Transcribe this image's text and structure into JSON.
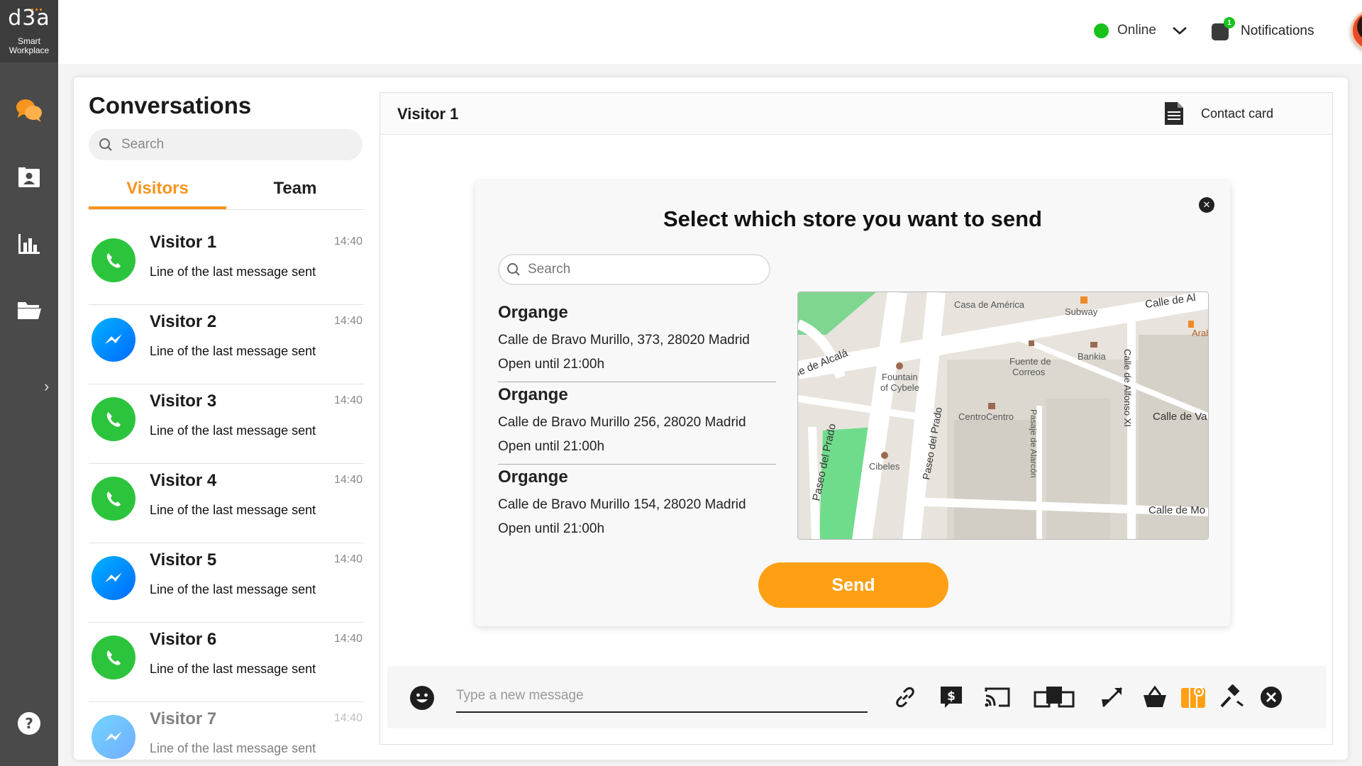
{
  "app": {
    "logo_mark": "d3a",
    "logo_line1": "Smart",
    "logo_line2": "Workplace"
  },
  "nav": {
    "items": [
      {
        "icon": "chat-bubbles-icon",
        "active": true
      },
      {
        "icon": "contacts-icon",
        "active": false
      },
      {
        "icon": "bar-chart-icon",
        "active": false
      },
      {
        "icon": "folder-icon",
        "active": false
      }
    ],
    "expand_glyph": "›",
    "help_glyph": "?"
  },
  "topbar": {
    "status_label": "Online",
    "status_color": "#17c21b",
    "notifications_label": "Notifications",
    "notifications_count": "1"
  },
  "conversations": {
    "title": "Conversations",
    "search_placeholder": "Search",
    "tabs": [
      {
        "label": "Visitors",
        "active": true
      },
      {
        "label": "Team",
        "active": false
      }
    ],
    "items": [
      {
        "name": "Visitor 1",
        "time": "14:40",
        "last": "Line of the last message sent",
        "channel": "whatsapp"
      },
      {
        "name": "Visitor 2",
        "time": "14:40",
        "last": "Line of the last message sent",
        "channel": "messenger"
      },
      {
        "name": "Visitor 3",
        "time": "14:40",
        "last": "Line of the last message sent",
        "channel": "whatsapp"
      },
      {
        "name": "Visitor 4",
        "time": "14:40",
        "last": "Line of the last message sent",
        "channel": "whatsapp"
      },
      {
        "name": "Visitor 5",
        "time": "14:40",
        "last": "Line of the last message sent",
        "channel": "messenger"
      },
      {
        "name": "Visitor 6",
        "time": "14:40",
        "last": "Line of the last message sent",
        "channel": "whatsapp"
      },
      {
        "name": "Visitor 7",
        "time": "14:40",
        "last": "Line of the last message sent",
        "channel": "messenger"
      }
    ]
  },
  "chat": {
    "title": "Visitor 1",
    "contact_card_label": "Contact card"
  },
  "modal": {
    "title": "Select which store you want to send",
    "search_placeholder": "Search",
    "send_label": "Send",
    "stores": [
      {
        "name": "Organge",
        "address": "Calle de Bravo Murillo, 373, 28020 Madrid",
        "hours": "Open until 21:00h"
      },
      {
        "name": "Organge",
        "address": "Calle de Bravo Murillo 256, 28020 Madrid",
        "hours": "Open until 21:00h"
      },
      {
        "name": "Organge",
        "address": "Calle de Bravo Murillo 154, 28020 Madrid",
        "hours": "Open until 21:00h"
      }
    ],
    "map_labels": {
      "casa": "Casa de América",
      "subway": "Subway",
      "calle_al": "Calle de Al",
      "arahy": "Arahy",
      "alcala": "le de Alcalá",
      "fountain1": "Fountain",
      "fountain2": "of Cybele",
      "fuente1": "Fuente de",
      "fuente2": "Correos",
      "bankia": "Bankia",
      "alfonso": "Calle de Alfonso XI",
      "calle_va": "Calle de Va",
      "centro": "CentroCentro",
      "alarcon": "Pasaje de Alarcón",
      "prado1": "Paseo del Prado",
      "prado2": "Paseo del Prado",
      "cibeles": "Cibeles",
      "calle_mo": "Calle de Mo"
    }
  },
  "composer": {
    "placeholder": "Type a new message",
    "tools": [
      "link-icon",
      "payment-icon",
      "cast-icon",
      "screen-share-icon",
      "transfer-icon",
      "basket-icon",
      "map-pin-icon",
      "auction-icon",
      "end-chat-icon"
    ]
  },
  "colors": {
    "accent": "#f7941d",
    "send_button": "#ffa014",
    "whatsapp": "#2cc43c",
    "messenger": "#0084ff",
    "rail": "#4a4a4a"
  }
}
